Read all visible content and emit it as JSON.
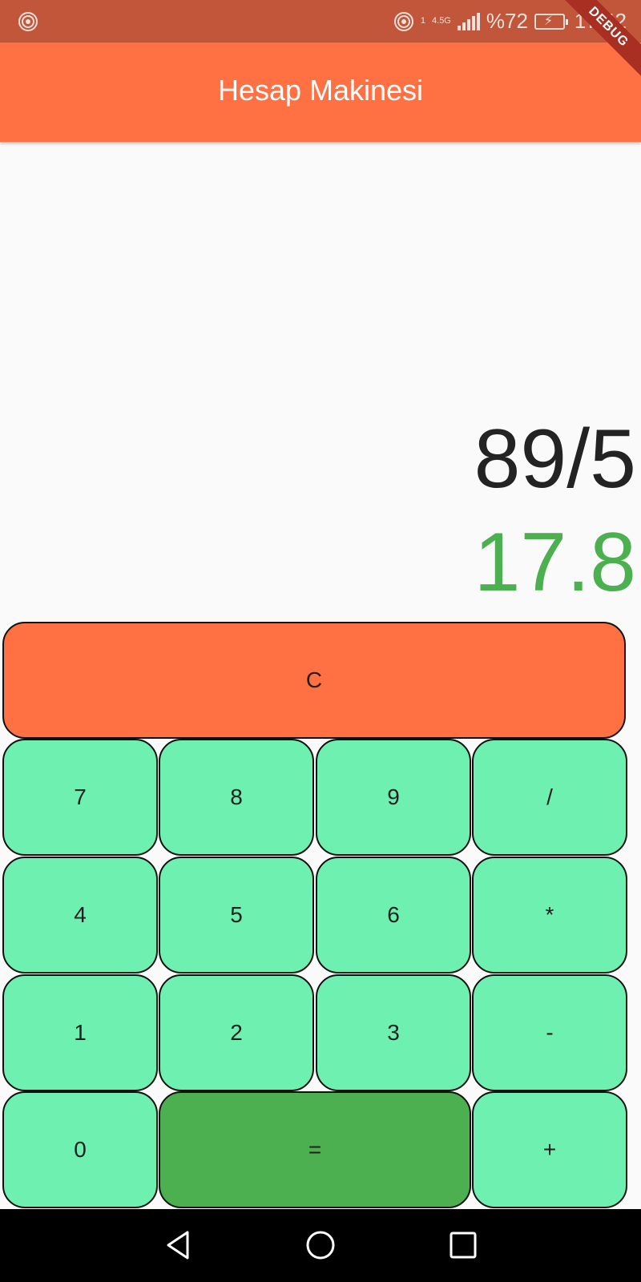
{
  "status_bar": {
    "network_label": "4.5G",
    "sim_index": "1",
    "battery": "%72",
    "time": "17:42"
  },
  "debug_banner": "DEBUG",
  "app_bar": {
    "title": "Hesap Makinesi"
  },
  "display": {
    "expression": "89/5",
    "result": "17.8"
  },
  "keypad": {
    "clear": "C",
    "row1": [
      "7",
      "8",
      "9",
      "/"
    ],
    "row2": [
      "4",
      "5",
      "6",
      "*"
    ],
    "row3": [
      "1",
      "2",
      "3",
      "-"
    ],
    "row4": {
      "zero": "0",
      "equals": "=",
      "plus": "+"
    }
  },
  "icons": {
    "hotspot": "hotspot-icon",
    "signal": "signal-icon",
    "battery": "battery-charging-icon",
    "back": "back-triangle-icon",
    "home": "home-circle-icon",
    "recents": "recents-square-icon"
  },
  "colors": {
    "status_bar": "#c1563a",
    "app_bar": "#ff7043",
    "clear_key": "#ff7043",
    "digit_key": "#6ef0b0",
    "equals_key": "#4caf50",
    "result_text": "#4caf50"
  }
}
